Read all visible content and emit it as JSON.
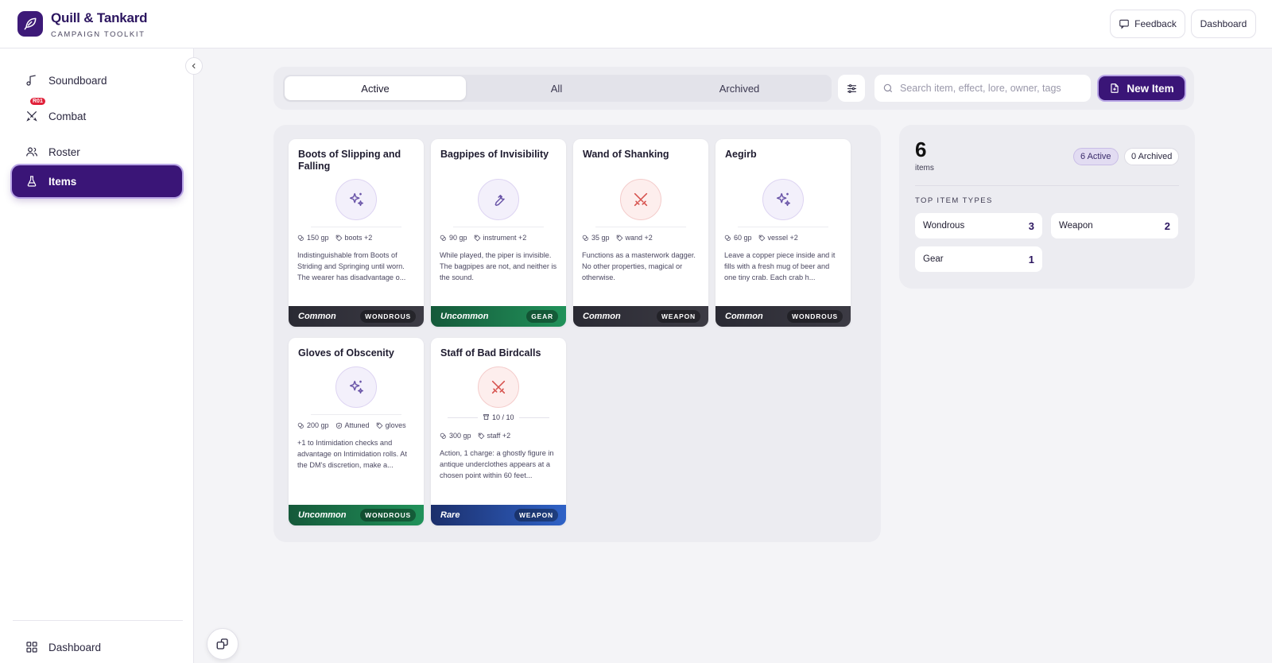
{
  "brand": {
    "title": "Quill & Tankard",
    "subtitle": "CAMPAIGN TOOLKIT"
  },
  "header": {
    "feedback_label": "Feedback",
    "dashboard_label": "Dashboard"
  },
  "sidebar": {
    "items": [
      {
        "label": "Soundboard",
        "icon": "music-note-icon"
      },
      {
        "label": "Combat",
        "icon": "crossed-swords-icon",
        "badge": "R01"
      },
      {
        "label": "Roster",
        "icon": "users-icon"
      },
      {
        "label": "Items",
        "icon": "flask-icon",
        "active": true
      }
    ],
    "footer_label": "Dashboard"
  },
  "toolbar": {
    "tabs": [
      "Active",
      "All",
      "Archived"
    ],
    "active_tab": "Active",
    "search_placeholder": "Search item, effect, lore, owner, tags",
    "new_item_label": "New Item"
  },
  "items": [
    {
      "title": "Boots of Slipping and Falling",
      "kind": "wondrous",
      "price": "150 gp",
      "tag": "boots +2",
      "desc": "Indistinguishable from Boots of Striding and Springing until worn. The wearer has disadvantage o...",
      "rarity": "Common",
      "type": "WONDROUS"
    },
    {
      "title": "Bagpipes of Invisibility",
      "kind": "gear",
      "price": "90 gp",
      "tag": "instrument +2",
      "desc": "While played, the piper is invisible. The bagpipes are not, and neither is the sound.",
      "rarity": "Uncommon",
      "type": "GEAR"
    },
    {
      "title": "Wand of Shanking",
      "kind": "weapon",
      "price": "35 gp",
      "tag": "wand +2",
      "desc": "Functions as a masterwork dagger. No other properties, magical or otherwise.",
      "rarity": "Common",
      "type": "WEAPON"
    },
    {
      "title": "Aegirb",
      "kind": "wondrous",
      "price": "60 gp",
      "tag": "vessel +2",
      "desc": "Leave a copper piece inside and it fills with a fresh mug of beer and one tiny crab. Each crab h...",
      "rarity": "Common",
      "type": "WONDROUS"
    },
    {
      "title": "Gloves of Obscenity",
      "kind": "wondrous",
      "price": "200 gp",
      "attuned": "Attuned",
      "tag": "gloves",
      "desc": "+1 to Intimidation checks and advantage on Intimidation rolls. At the DM's discretion, make a...",
      "rarity": "Uncommon",
      "type": "WONDROUS"
    },
    {
      "title": "Staff of Bad Birdcalls",
      "kind": "weapon",
      "charges": "10 / 10",
      "price": "300 gp",
      "tag": "staff +2",
      "desc": "Action, 1 charge: a ghostly figure in antique underclothes appears at a chosen point within 60 feet...",
      "rarity": "Rare",
      "type": "WEAPON"
    }
  ],
  "stats": {
    "count": "6",
    "count_label": "items",
    "active_pill": "6 Active",
    "archived_pill": "0 Archived",
    "section_title": "TOP ITEM TYPES",
    "types": [
      {
        "label": "Wondrous",
        "count": "3"
      },
      {
        "label": "Weapon",
        "count": "2"
      },
      {
        "label": "Gear",
        "count": "1"
      }
    ]
  },
  "colors": {
    "brand": "#3a1577",
    "common": "#2a2a33",
    "uncommon": "#1a7a4a",
    "rare": "#2a56b8"
  }
}
